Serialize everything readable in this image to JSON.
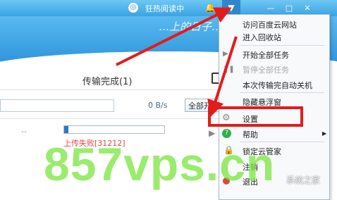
{
  "title_bar": {
    "status_text": "狂热阅读中",
    "bell_glyph": "🔔",
    "menu_glyph": "▼",
    "min_glyph": "—",
    "max_glyph": "□",
    "close_glyph": "✕"
  },
  "banner": {
    "slogan": "…上的日子…"
  },
  "tabs": {
    "completed": "传输完成(1)"
  },
  "toolbar": {
    "speed": "0 B/s",
    "start_all": "全部开始"
  },
  "task": {
    "dashes": "--",
    "status": "上传失败[31212]"
  },
  "menu": {
    "items": [
      {
        "label": "访问百度云网站"
      },
      {
        "label": "进入回收站"
      },
      {
        "label": "开始全部任务"
      },
      {
        "label": "暂停全部任务"
      },
      {
        "label": "本次传输完自动关机"
      },
      {
        "label": "隐藏悬浮窗"
      },
      {
        "label": "设置"
      },
      {
        "label": "帮助"
      },
      {
        "label": "锁定云管家"
      },
      {
        "label": "注销"
      },
      {
        "label": "退出"
      }
    ]
  },
  "watermark": {
    "main": "857vps.cn",
    "corner": "系统之家"
  },
  "colors": {
    "accent": "#3aa3e3",
    "highlight": "#e41b1b",
    "watermark": "#78e63c"
  }
}
